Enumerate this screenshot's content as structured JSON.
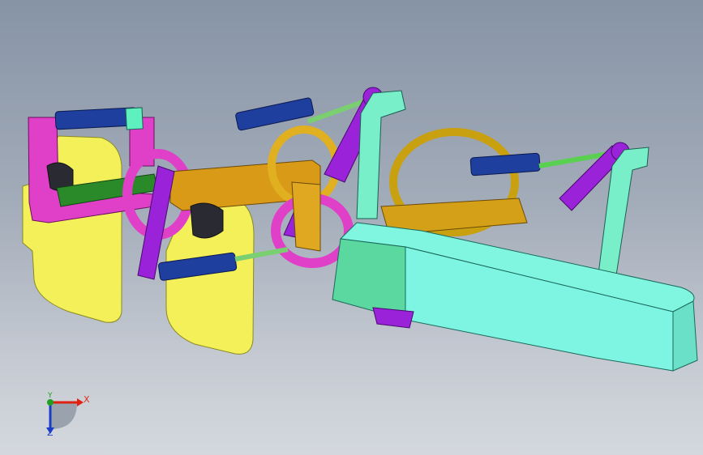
{
  "viewport": {
    "colors": {
      "yellow_plate": "#f4f05a",
      "magenta": "#e040c8",
      "blue_cylinder": "#1e3f9e",
      "green_rod": "#2a8a2a",
      "orange": "#d99a18",
      "purple": "#9a22d8",
      "teal": "#72f0d8",
      "gold_ring": "#d4a812",
      "cyan_body": "#7ef5e2"
    }
  },
  "triad": {
    "x_label": "X",
    "y_label": "Y",
    "z_label": "Z",
    "colors": {
      "x": "#e02010",
      "y": "#20a020",
      "z": "#1a3cc8"
    }
  }
}
